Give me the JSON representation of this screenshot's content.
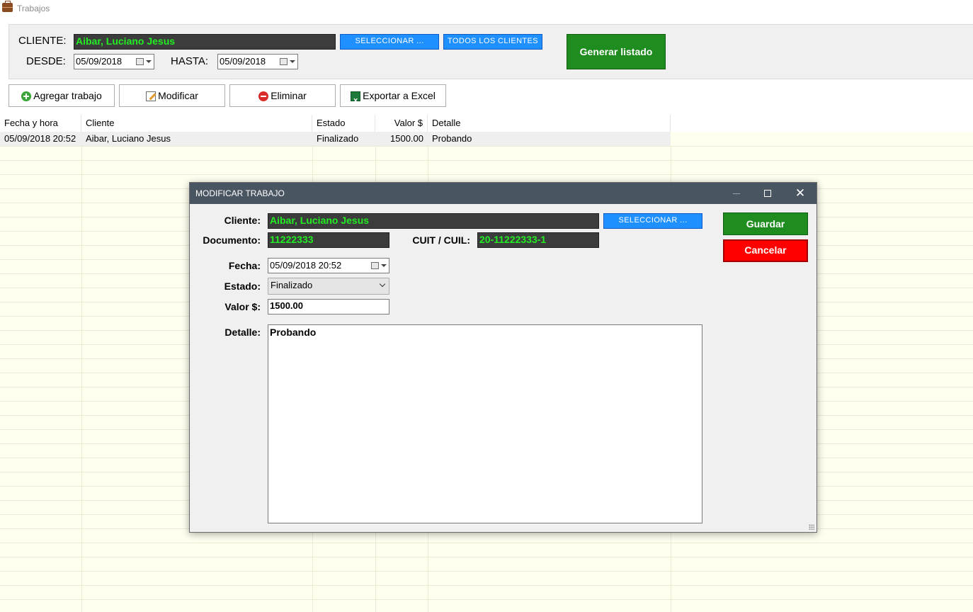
{
  "window": {
    "title": "Trabajos"
  },
  "filter": {
    "cliente_label": "CLIENTE:",
    "cliente_value": "Aibar, Luciano Jesus",
    "seleccionar_label": "SELECCIONAR ...",
    "todos_label": "TODOS LOS CLIENTES",
    "desde_label": "DESDE:",
    "desde_value": "05/09/2018",
    "hasta_label": "HASTA:",
    "hasta_value": "05/09/2018",
    "generar_label": "Generar listado"
  },
  "toolbar": {
    "agregar": "Agregar trabajo",
    "modificar": "Modificar",
    "eliminar": "Eliminar",
    "exportar": "Exportar a Excel"
  },
  "table": {
    "columns": [
      "Fecha y hora",
      "Cliente",
      "Estado",
      "Valor $",
      "Detalle"
    ],
    "rows": [
      [
        "05/09/2018 20:52",
        "Aibar, Luciano Jesus",
        "Finalizado",
        "1500.00",
        "Probando"
      ]
    ]
  },
  "dialog": {
    "title": "MODIFICAR TRABAJO",
    "cliente_label": "Cliente:",
    "cliente_value": "Aibar, Luciano Jesus",
    "seleccionar_label": "SELECCIONAR ...",
    "documento_label": "Documento:",
    "documento_value": "11222333",
    "cuit_label": "CUIT / CUIL:",
    "cuit_value": "20-11222333-1",
    "fecha_label": "Fecha:",
    "fecha_value": "05/09/2018 20:52",
    "estado_label": "Estado:",
    "estado_value": "Finalizado",
    "valor_label": "Valor $:",
    "valor_value": "1500.00",
    "detalle_label": "Detalle:",
    "detalle_value": "Probando",
    "guardar_label": "Guardar",
    "cancelar_label": "Cancelar"
  },
  "colors": {
    "accent_blue": "#1e90ff",
    "save_green": "#1e8c1e",
    "cancel_red": "#ff0000",
    "field_text_green": "#22ee22",
    "grid_background": "#fffff0"
  }
}
